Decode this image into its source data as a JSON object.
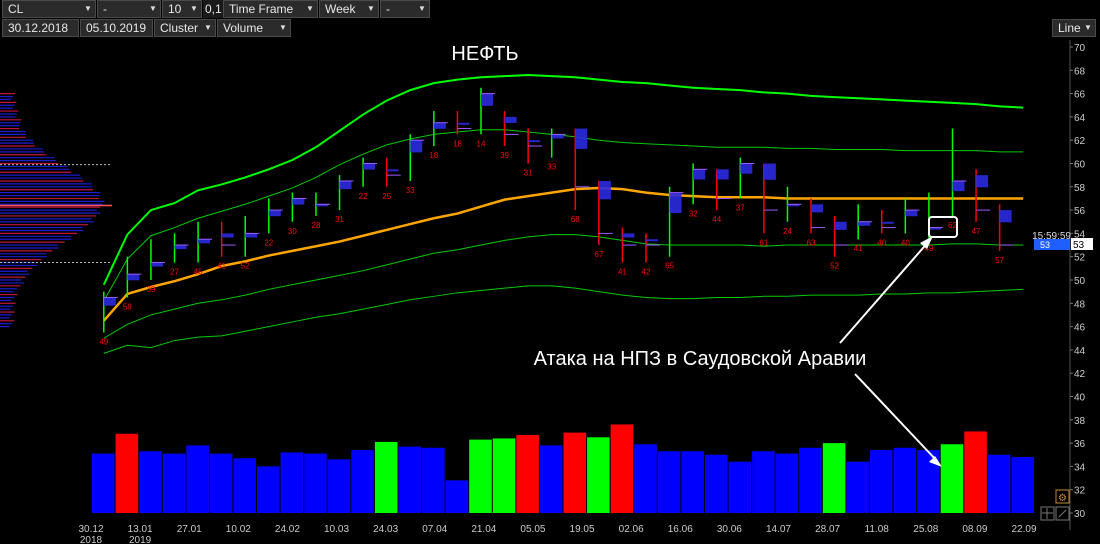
{
  "toolbar": {
    "symbol": "CL",
    "field2": "-",
    "period_count": "10",
    "step": "0,1",
    "timeframe_label": "Time Frame",
    "timeframe_value": "Week",
    "field7": "-",
    "date_from": "30.12.2018",
    "date_to": "05.10.2019",
    "mode": "Cluster",
    "metric": "Volume",
    "chart_style": "Line"
  },
  "chart_data": {
    "type": "bar",
    "title": "НЕФТЬ",
    "annotation": "Атака на НПЗ в Саудовской Аравии",
    "time_label": "15:59:59",
    "price_marker": "53",
    "price_marker_right": "53",
    "x_labels": [
      "30.12",
      "13.01",
      "27.01",
      "10.02",
      "24.02",
      "10.03",
      "24.03",
      "07.04",
      "21.04",
      "05.05",
      "19.05",
      "02.06",
      "16.06",
      "30.06",
      "14.07",
      "28.07",
      "11.08",
      "25.08",
      "08.09",
      "22.09"
    ],
    "x_labels_year": [
      "2018",
      "2019"
    ],
    "price_axis": {
      "min": 30,
      "max": 70,
      "step": 2
    },
    "price_ticks": [
      "70",
      "68",
      "66",
      "64",
      "62",
      "60",
      "58",
      "56",
      "54",
      "52",
      "50",
      "48",
      "46",
      "44",
      "42",
      "40",
      "38",
      "36",
      "34",
      "32",
      "30"
    ],
    "colors": {
      "background": "#000000",
      "blue": "#0000ff",
      "green": "#00ff00",
      "red": "#ff0000",
      "ma": "#ffa500",
      "band": "#00cc00",
      "marker": "#1f5fff"
    },
    "volume_bars": [
      {
        "v": 35.1,
        "c": "blue"
      },
      {
        "v": 36.8,
        "c": "red"
      },
      {
        "v": 35.3,
        "c": "blue"
      },
      {
        "v": 35.1,
        "c": "blue"
      },
      {
        "v": 35.8,
        "c": "blue"
      },
      {
        "v": 35.1,
        "c": "blue"
      },
      {
        "v": 34.7,
        "c": "blue"
      },
      {
        "v": 34.0,
        "c": "blue"
      },
      {
        "v": 35.2,
        "c": "blue"
      },
      {
        "v": 35.1,
        "c": "blue"
      },
      {
        "v": 34.6,
        "c": "blue"
      },
      {
        "v": 35.4,
        "c": "blue"
      },
      {
        "v": 36.1,
        "c": "green"
      },
      {
        "v": 35.7,
        "c": "blue"
      },
      {
        "v": 35.6,
        "c": "blue"
      },
      {
        "v": 32.8,
        "c": "blue"
      },
      {
        "v": 36.3,
        "c": "green"
      },
      {
        "v": 36.4,
        "c": "green"
      },
      {
        "v": 36.7,
        "c": "red"
      },
      {
        "v": 35.8,
        "c": "blue"
      },
      {
        "v": 36.9,
        "c": "red"
      },
      {
        "v": 36.5,
        "c": "green"
      },
      {
        "v": 37.6,
        "c": "red"
      },
      {
        "v": 35.9,
        "c": "blue"
      },
      {
        "v": 35.3,
        "c": "blue"
      },
      {
        "v": 35.3,
        "c": "blue"
      },
      {
        "v": 35.0,
        "c": "blue"
      },
      {
        "v": 34.4,
        "c": "blue"
      },
      {
        "v": 35.3,
        "c": "blue"
      },
      {
        "v": 35.1,
        "c": "blue"
      },
      {
        "v": 35.6,
        "c": "blue"
      },
      {
        "v": 36.0,
        "c": "green"
      },
      {
        "v": 34.4,
        "c": "blue"
      },
      {
        "v": 35.4,
        "c": "blue"
      },
      {
        "v": 35.6,
        "c": "blue"
      },
      {
        "v": 35.4,
        "c": "blue"
      },
      {
        "v": 35.9,
        "c": "green"
      },
      {
        "v": 37.0,
        "c": "red"
      },
      {
        "v": 35.0,
        "c": "blue"
      },
      {
        "v": 34.8,
        "c": "blue"
      }
    ],
    "moving_average": [
      46.5,
      48.8,
      49.4,
      49.9,
      50.5,
      51.2,
      51.6,
      52.1,
      52.5,
      52.9,
      53.3,
      53.8,
      54.3,
      54.8,
      55.3,
      55.7,
      56.3,
      56.9,
      57.2,
      57.5,
      57.8,
      57.9,
      57.8,
      57.5,
      57.3,
      57.2,
      57.1,
      57.1,
      57.1,
      57.0,
      57.0,
      57.0,
      57.0,
      57.0,
      57.0,
      57.0,
      57.0,
      57.0,
      57.0,
      57.0
    ],
    "upper_band_outer": [
      49.6,
      53.9,
      56.0,
      56.6,
      57.7,
      58.2,
      58.8,
      59.5,
      60.3,
      61.4,
      62.8,
      64.2,
      65.4,
      66.3,
      66.9,
      67.2,
      67.4,
      67.5,
      67.6,
      67.5,
      67.4,
      67.2,
      67.0,
      66.9,
      66.7,
      66.5,
      66.4,
      66.3,
      66.1,
      66.0,
      65.8,
      65.7,
      65.6,
      65.5,
      65.4,
      65.3,
      65.2,
      65.1,
      64.9,
      64.8
    ],
    "upper_band_inner": [
      48.2,
      51.8,
      53.8,
      54.5,
      55.3,
      55.9,
      56.5,
      57.2,
      57.9,
      58.8,
      59.9,
      60.8,
      61.6,
      62.1,
      62.5,
      62.7,
      62.9,
      62.9,
      62.7,
      62.5,
      62.3,
      62.0,
      61.8,
      61.7,
      61.6,
      61.5,
      61.4,
      61.4,
      61.4,
      61.3,
      61.3,
      61.2,
      61.2,
      61.2,
      61.1,
      61.1,
      61.1,
      61.1,
      61.0,
      61.0
    ],
    "lower_band_inner": [
      45.0,
      46.2,
      47.0,
      47.5,
      48.0,
      48.3,
      48.7,
      49.2,
      49.6,
      50.0,
      50.4,
      50.8,
      51.3,
      51.8,
      52.3,
      52.6,
      53.0,
      53.4,
      53.7,
      53.9,
      53.9,
      53.7,
      53.4,
      53.1,
      53.0,
      53.0,
      53.0,
      53.0,
      52.9,
      53.0,
      53.0,
      53.0,
      53.0,
      53.0,
      53.0,
      53.0,
      53.1,
      53.1,
      53.0,
      53.0
    ],
    "lower_band_outer": [
      43.7,
      44.4,
      44.2,
      44.8,
      45.1,
      45.2,
      45.6,
      46.0,
      46.4,
      46.8,
      47.1,
      47.5,
      47.9,
      48.3,
      48.6,
      48.9,
      49.1,
      49.3,
      49.5,
      49.5,
      49.3,
      49.0,
      48.7,
      48.5,
      48.4,
      48.4,
      48.5,
      48.5,
      48.6,
      48.6,
      48.7,
      48.7,
      48.7,
      48.8,
      48.8,
      48.9,
      48.9,
      49.0,
      49.1,
      49.2
    ],
    "price_bars": [
      {
        "o": 46.5,
        "c": 48.5,
        "h": 49.0,
        "l": 45.5,
        "lbl": "49"
      },
      {
        "o": 49.0,
        "c": 50.5,
        "h": 52.0,
        "l": 48.5,
        "lbl": "59"
      },
      {
        "o": 50.5,
        "c": 51.5,
        "h": 53.5,
        "l": 50.0,
        "lbl": "39"
      },
      {
        "o": 52.0,
        "c": 53.0,
        "h": 54.0,
        "l": 51.5,
        "lbl": "27"
      },
      {
        "o": 52.5,
        "c": 53.5,
        "h": 55.0,
        "l": 51.5,
        "lbl": "45"
      },
      {
        "o": 54.0,
        "c": 53.0,
        "h": 55.0,
        "l": 52.0,
        "lbl": "41"
      },
      {
        "o": 53.0,
        "c": 54.0,
        "h": 55.5,
        "l": 52.0,
        "lbl": "52"
      },
      {
        "o": 54.5,
        "c": 56.0,
        "h": 57.0,
        "l": 54.0,
        "lbl": "22"
      },
      {
        "o": 55.5,
        "c": 57.0,
        "h": 57.5,
        "l": 55.0,
        "lbl": "30"
      },
      {
        "o": 56.0,
        "c": 56.5,
        "h": 57.5,
        "l": 55.5,
        "lbl": "28"
      },
      {
        "o": 56.5,
        "c": 58.5,
        "h": 59.0,
        "l": 56.0,
        "lbl": "31"
      },
      {
        "o": 58.5,
        "c": 60.0,
        "h": 60.5,
        "l": 58.0,
        "lbl": "22"
      },
      {
        "o": 59.5,
        "c": 59.0,
        "h": 60.5,
        "l": 58.0,
        "lbl": "25"
      },
      {
        "o": 59.0,
        "c": 62.0,
        "h": 62.5,
        "l": 58.5,
        "lbl": "33"
      },
      {
        "o": 62.0,
        "c": 63.5,
        "h": 64.5,
        "l": 61.5,
        "lbl": "18"
      },
      {
        "o": 63.5,
        "c": 63.0,
        "h": 64.5,
        "l": 62.5,
        "lbl": "18"
      },
      {
        "o": 63.0,
        "c": 66.0,
        "h": 66.5,
        "l": 62.5,
        "lbl": "14"
      },
      {
        "o": 64.0,
        "c": 62.5,
        "h": 64.5,
        "l": 61.5,
        "lbl": "39"
      },
      {
        "o": 62.0,
        "c": 61.5,
        "h": 63.0,
        "l": 60.0,
        "lbl": "31"
      },
      {
        "o": 61.5,
        "c": 62.5,
        "h": 63.0,
        "l": 60.5,
        "lbl": "33"
      },
      {
        "o": 63.0,
        "c": 58.0,
        "h": 63.0,
        "l": 56.0,
        "lbl": "68"
      },
      {
        "o": 58.5,
        "c": 54.0,
        "h": 58.5,
        "l": 53.0,
        "lbl": "67"
      },
      {
        "o": 54.0,
        "c": 53.0,
        "h": 54.5,
        "l": 51.5,
        "lbl": "41"
      },
      {
        "o": 53.5,
        "c": 53.0,
        "h": 54.0,
        "l": 51.5,
        "lbl": "42"
      },
      {
        "o": 52.5,
        "c": 57.5,
        "h": 58.0,
        "l": 52.0,
        "lbl": "65"
      },
      {
        "o": 57.0,
        "c": 59.5,
        "h": 60.0,
        "l": 56.5,
        "lbl": "32"
      },
      {
        "o": 59.5,
        "c": 57.0,
        "h": 59.5,
        "l": 56.0,
        "lbl": "44"
      },
      {
        "o": 57.5,
        "c": 60.0,
        "h": 60.5,
        "l": 57.0,
        "lbl": "37"
      },
      {
        "o": 60.0,
        "c": 56.0,
        "h": 60.0,
        "l": 54.0,
        "lbl": "61"
      },
      {
        "o": 56.0,
        "c": 56.5,
        "h": 58.0,
        "l": 55.0,
        "lbl": "24"
      },
      {
        "o": 56.5,
        "c": 54.5,
        "h": 57.0,
        "l": 54.0,
        "lbl": "63"
      },
      {
        "o": 55.0,
        "c": 53.0,
        "h": 55.5,
        "l": 52.0,
        "lbl": "52"
      },
      {
        "o": 54.0,
        "c": 55.0,
        "h": 56.5,
        "l": 53.5,
        "lbl": "41"
      },
      {
        "o": 55.0,
        "c": 54.5,
        "h": 56.0,
        "l": 54.0,
        "lbl": "40"
      },
      {
        "o": 54.5,
        "c": 56.0,
        "h": 57.0,
        "l": 54.0,
        "lbl": "40"
      },
      {
        "o": 54.0,
        "c": 54.5,
        "h": 57.5,
        "l": 53.5,
        "lbl": "49"
      },
      {
        "o": 56.0,
        "c": 58.5,
        "h": 63.0,
        "l": 55.5,
        "lbl": "62"
      },
      {
        "o": 59.0,
        "c": 56.0,
        "h": 59.5,
        "l": 55.0,
        "lbl": "47"
      },
      {
        "o": 56.0,
        "c": 53.0,
        "h": 56.5,
        "l": 52.5,
        "lbl": "57"
      },
      {
        "o": 53.0,
        "c": 53.0,
        "h": 53.0,
        "l": 53.0,
        "lbl": ""
      }
    ]
  }
}
